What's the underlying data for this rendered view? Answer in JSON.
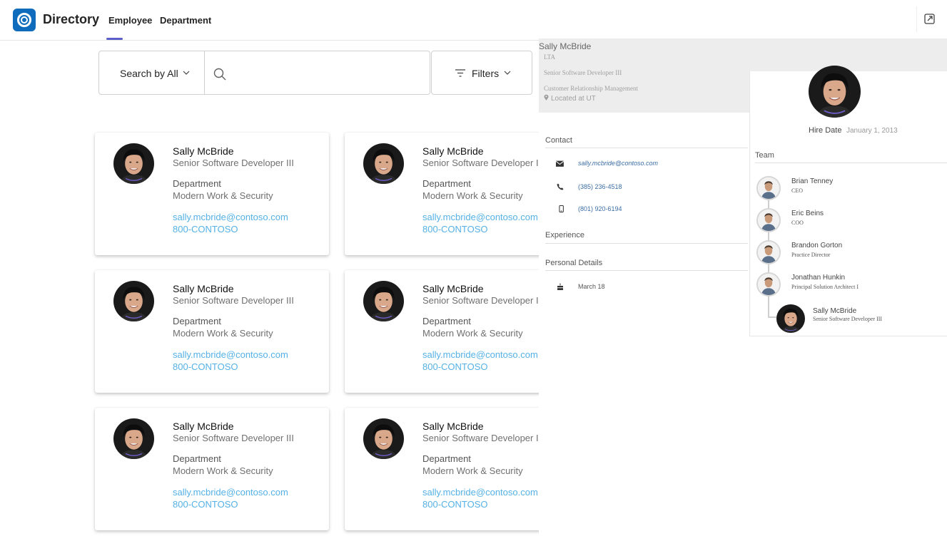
{
  "header": {
    "app_title": "Directory",
    "tabs": [
      {
        "label": "Employee",
        "active": true
      },
      {
        "label": "Department",
        "active": false
      }
    ],
    "accent_color": "#5b5fc7",
    "logo_color": "#0f6cbd",
    "popout_icon": "pop-out-icon"
  },
  "search": {
    "scope_label": "Search by All",
    "input_value": "",
    "filters_label": "Filters"
  },
  "cards": [
    {
      "name": "Sally McBride",
      "title": "Senior Software Developer III",
      "dept_label": "Department",
      "dept": "Modern Work & Security",
      "email": "sally.mcbride@contoso.com",
      "phone": "800-CONTOSO"
    },
    {
      "name": "Sally McBride",
      "title": "Senior Software Developer III",
      "dept_label": "Department",
      "dept": "Modern Work & Security",
      "email": "sally.mcbride@contoso.com",
      "phone": "800-CONTOSO"
    },
    {
      "name": "Sally McBride",
      "title": "Senior Software Developer III",
      "dept_label": "Department",
      "dept": "Modern Work & Security",
      "email": "sally.mcbride@contoso.com",
      "phone": "800-CONTOSO"
    },
    {
      "name": "Sally McBride",
      "title": "Senior Software Developer III",
      "dept_label": "Department",
      "dept": "Modern Work & Security",
      "email": "sally.mcbride@contoso.com",
      "phone": "800-CONTOSO"
    },
    {
      "name": "Sally McBride",
      "title": "Senior Software Developer III",
      "dept_label": "Department",
      "dept": "Modern Work & Security",
      "email": "sally.mcbride@contoso.com",
      "phone": "800-CONTOSO"
    },
    {
      "name": "Sally McBride",
      "title": "Senior Software Developer III",
      "dept_label": "Department",
      "dept": "Modern Work & Security",
      "email": "sally.mcbride@contoso.com",
      "phone": "800-CONTOSO"
    }
  ],
  "detail": {
    "name": "Sally McBride",
    "lta": "LTA",
    "role": "Senior Software Developer III",
    "org": "Customer Relationship Management",
    "location": "Located at UT",
    "contact_heading": "Contact",
    "email": "sally.mcbride@contoso.com",
    "phone1": "(385) 236-4518",
    "phone2": "(801) 920-6194",
    "experience_heading": "Experience",
    "personal_heading": "Personal Details",
    "birthday": "March 18",
    "hire_label": "Hire Date",
    "hire_date": "January 1, 2013",
    "team_heading": "Team",
    "team": [
      {
        "name": "Brian Tenney",
        "role": "CEO"
      },
      {
        "name": "Eric Beins",
        "role": "COO"
      },
      {
        "name": "Brandon Gorton",
        "role": "Practice Director"
      },
      {
        "name": "Jonathan Hunkin",
        "role": "Principal Solution Architect I"
      },
      {
        "name": "Sally McBride",
        "role": "Senior Software Developer III"
      }
    ]
  }
}
